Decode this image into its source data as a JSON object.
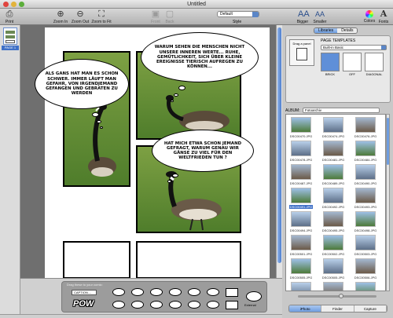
{
  "window": {
    "title": "Untitled"
  },
  "toolbar": {
    "print": "Print",
    "zoom_in": "Zoom In",
    "zoom_out": "Zoom Out",
    "zoom_fit": "Zoom to Fit",
    "front": "Front",
    "back": "Back",
    "style_value": "Default",
    "style_label": "Style",
    "bigger": "Bigger",
    "smaller": "Smaller",
    "colors": "Colors",
    "fonts": "Fonts"
  },
  "pages": [
    {
      "label": "PAGE 1"
    }
  ],
  "comic": {
    "bubble1": "ALS GANS HAT MAN ES SCHON SCHWER. IMMER LÄUFT MAN GEFAHR, VON IRGENDJEMAND GEFANGEN UND GEBRATEN ZU WERDEN",
    "bubble2": "WARUM SEHEN DIE MENSCHEN NICHT UNSERE INNEREN WERTE... RUHE, GEMÜTLICHKEIT, SICH ÜBER KLEINE EREIGNISSE TIERISCH AUFREGEN ZU KÖNNEN...",
    "bubble3": "HAT MICH ETWA SCHON JEMAND GEFRAGT, WARUM GENAU WIR GÄNSE ZU VIEL FÜR DEN WELTFRIEDEN TUN ?"
  },
  "elements_tray": {
    "header": "Drag these to your comic:",
    "caption": "CAPTION....",
    "pow": "POW",
    "external": "External"
  },
  "right_panel": {
    "tabs": [
      "Libraries",
      "Details"
    ],
    "active_tab": "Libraries",
    "page_templates_label": "PAGE TEMPLATES",
    "template_set": "Built-in Basic",
    "drag_panel": "Drag a panel",
    "layouts": [
      "BRICK",
      "OFF",
      "DIAGONAL"
    ],
    "album_label": "ALBUM:",
    "album_value": "Fotoarchiv",
    "photos": [
      "DSC00470.JPG",
      "DSC00474.JPG",
      "DSC00476.JPG",
      "DSC00478.JPG",
      "DSC00481.JPG",
      "DSC00484.JPG",
      "DSC00487.JPG",
      "DSC00489.JPG",
      "DSC00490.JPG",
      "DSC00491.JPG",
      "DSC00492.JPG",
      "DSC00493.JPG",
      "DSC00494.JPG",
      "DSC00495.JPG",
      "DSC00498.JPG",
      "DSC00501.JPG",
      "DSC00502.JPG",
      "DSC00503.JPG",
      "DSC00505.JPG",
      "DSC00505.JPG",
      "DSC00506.JPG",
      "DSC00507.JPG",
      "DSC00508.JPG",
      "DSC00509.JPG",
      "DSC00510.JPG",
      "DSC00511.JPG",
      "DSC00512.JPG"
    ],
    "selected_photo_index": 9,
    "sources": [
      "iPhoto",
      "Finder",
      "Capture"
    ],
    "active_source": "iPhoto"
  }
}
